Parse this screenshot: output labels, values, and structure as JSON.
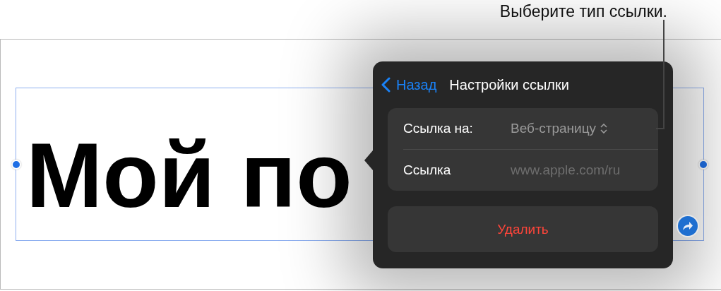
{
  "callout": {
    "text": "Выберите тип ссылки."
  },
  "slide": {
    "title": "Мой по"
  },
  "popover": {
    "back": "Назад",
    "title": "Настройки ссылки",
    "rows": [
      {
        "kind": "picker",
        "label": "Ссылка на:",
        "value": "Веб-страницу"
      },
      {
        "kind": "field",
        "label": "Ссылка",
        "placeholder": "www.apple.com/ru"
      }
    ],
    "delete": "Удалить"
  }
}
